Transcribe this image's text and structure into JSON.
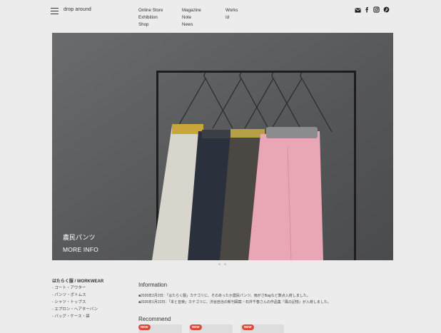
{
  "header": {
    "brand": "drop around",
    "nav": {
      "col1": [
        "Online Store",
        "Exhibition",
        "Shop"
      ],
      "col2": [
        "Magazine",
        "Note",
        "News"
      ],
      "col3": [
        "Works",
        "Id"
      ]
    },
    "social_icons": [
      "mail-icon",
      "facebook-icon",
      "instagram-icon",
      "pinterest-icon"
    ]
  },
  "hero": {
    "title": "農民パンツ",
    "more_label": "MORE INFO",
    "slides": 2
  },
  "category": {
    "title": "はたらく服 / WORKWEAR",
    "items": [
      "- コート・アウター",
      "- パンツ・ボトムス",
      "- シャツ・トップス",
      "- エプロン・ヘアターバン",
      "- バッグ・ケース・袋"
    ]
  },
  "information": {
    "title": "Information",
    "items": [
      "■2026年2月2日：「はたらく服」カテゴリに、そのあったか農民パンツ、雨がさBagなど数点入荷しました。",
      "■2026年1月22日：「本と音楽」カテゴリに、渋谷自治の新刊図案・石井千春さんの作品集『風の記憶』が入荷しました。"
    ]
  },
  "recommend": {
    "title": "Recommend",
    "badges": [
      "NEW",
      "NEW",
      "NEW"
    ]
  }
}
